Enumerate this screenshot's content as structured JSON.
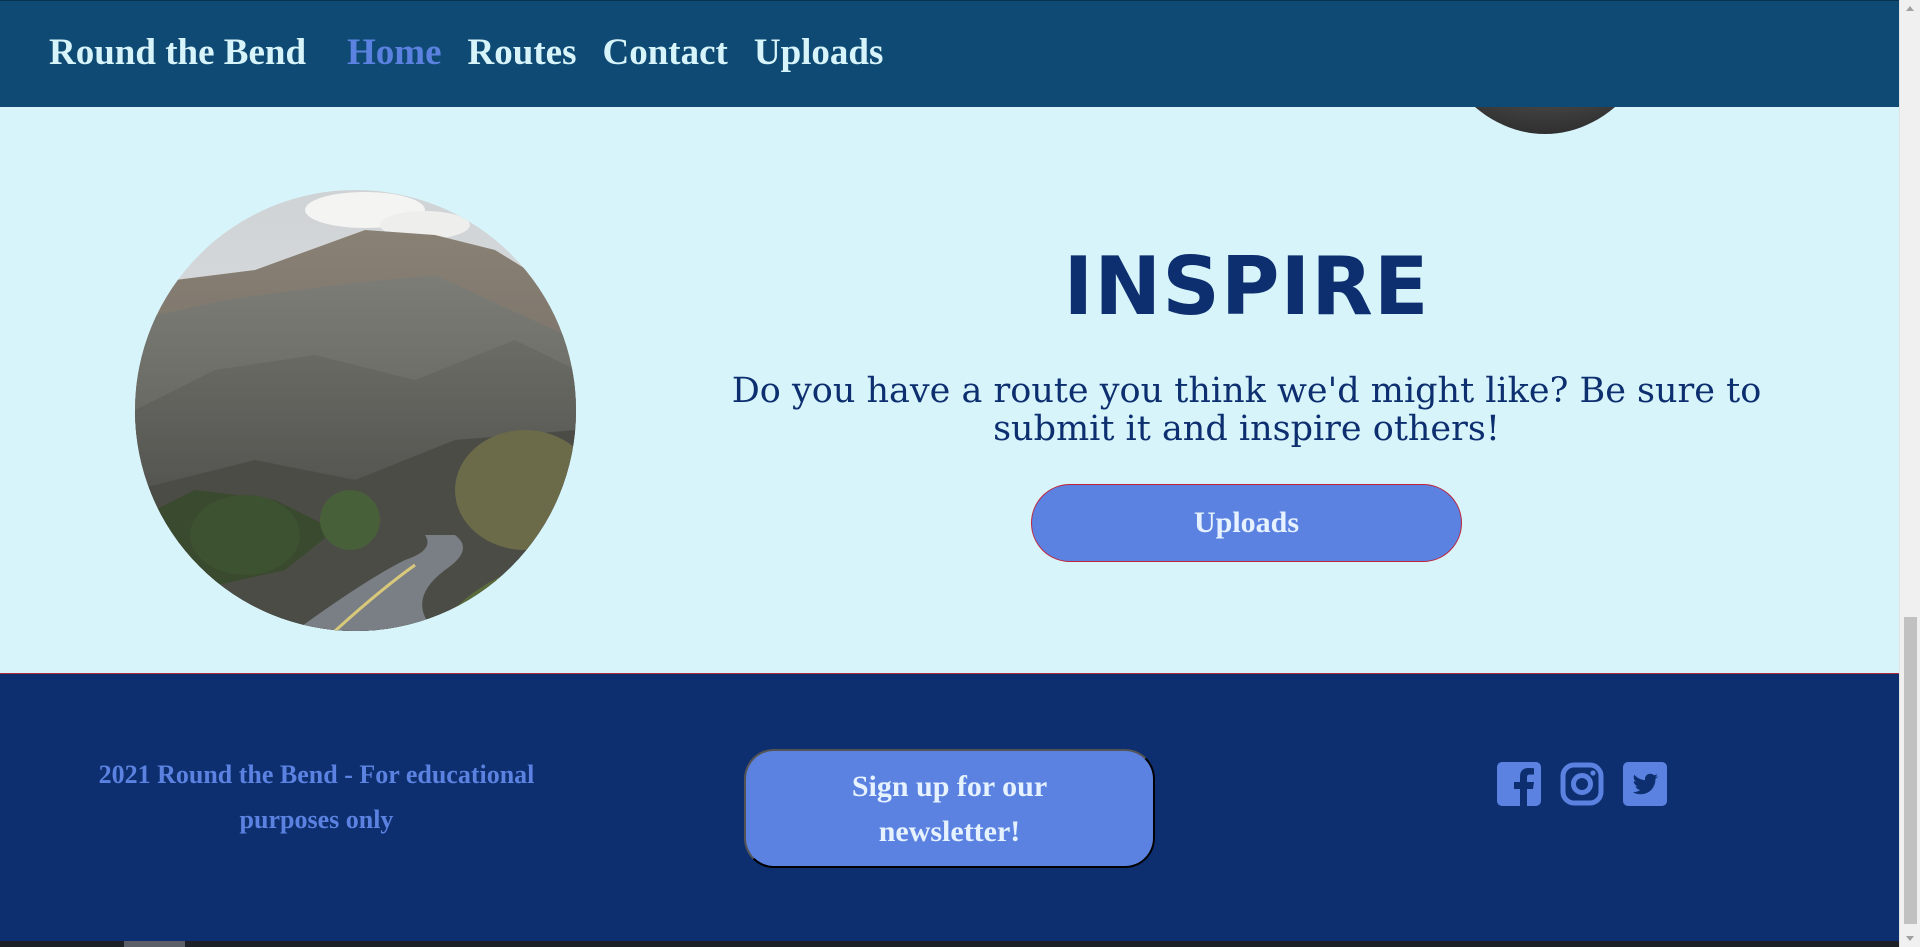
{
  "nav": {
    "brand": "Round the Bend",
    "links": [
      {
        "label": "Home",
        "active": true
      },
      {
        "label": "Routes",
        "active": false
      },
      {
        "label": "Contact",
        "active": false
      },
      {
        "label": "Uploads",
        "active": false
      }
    ]
  },
  "inspire": {
    "title": "INSPIRE",
    "text": "Do you have a route you think we'd might like? Be sure to submit it and inspire others!",
    "button_label": "Uploads",
    "image_icon": "mountain-road-photo"
  },
  "footer": {
    "copyright": "2021 Round the Bend - For educational purposes only",
    "newsletter_label": "Sign up for our newsletter!",
    "socials": [
      {
        "name": "facebook-icon"
      },
      {
        "name": "instagram-icon"
      },
      {
        "name": "twitter-icon"
      }
    ]
  },
  "colors": {
    "nav_bg": "#0f4a74",
    "section_bg": "#d7f4fa",
    "footer_bg": "#0d2f6f",
    "accent": "#5b82e0",
    "title": "#0d2f6f"
  }
}
